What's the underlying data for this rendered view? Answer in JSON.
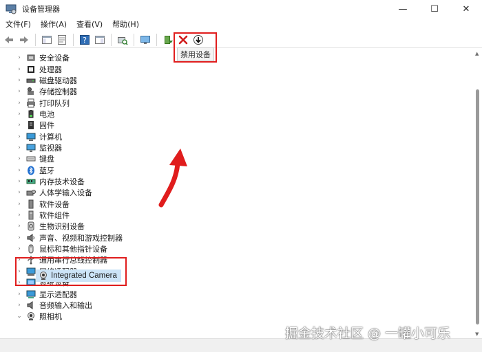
{
  "window": {
    "title": "设备管理器",
    "minimize": "—",
    "maximize": "☐",
    "close": "✕"
  },
  "menu": [
    {
      "label": "文件(F)"
    },
    {
      "label": "操作(A)"
    },
    {
      "label": "查看(V)"
    },
    {
      "label": "帮助(H)"
    }
  ],
  "tooltip": "禁用设备",
  "tree": {
    "categories": [
      {
        "label": "安全设备",
        "icon": "security-device-icon"
      },
      {
        "label": "处理器",
        "icon": "processor-icon"
      },
      {
        "label": "磁盘驱动器",
        "icon": "disk-drive-icon"
      },
      {
        "label": "存储控制器",
        "icon": "storage-controller-icon"
      },
      {
        "label": "打印队列",
        "icon": "printer-icon"
      },
      {
        "label": "电池",
        "icon": "battery-icon"
      },
      {
        "label": "固件",
        "icon": "firmware-icon"
      },
      {
        "label": "计算机",
        "icon": "computer-icon"
      },
      {
        "label": "监视器",
        "icon": "monitor-icon"
      },
      {
        "label": "键盘",
        "icon": "keyboard-icon"
      },
      {
        "label": "蓝牙",
        "icon": "bluetooth-icon"
      },
      {
        "label": "内存技术设备",
        "icon": "memory-device-icon"
      },
      {
        "label": "人体学输入设备",
        "icon": "hid-icon"
      },
      {
        "label": "软件设备",
        "icon": "software-device-icon"
      },
      {
        "label": "软件组件",
        "icon": "software-component-icon"
      },
      {
        "label": "生物识别设备",
        "icon": "biometric-icon"
      },
      {
        "label": "声音、视频和游戏控制器",
        "icon": "sound-icon"
      },
      {
        "label": "鼠标和其他指针设备",
        "icon": "mouse-icon"
      },
      {
        "label": "通用串行总线控制器",
        "icon": "usb-icon"
      },
      {
        "label": "网络适配器",
        "icon": "network-adapter-icon"
      },
      {
        "label": "系统设备",
        "icon": "system-device-icon"
      },
      {
        "label": "显示适配器",
        "icon": "display-adapter-icon"
      },
      {
        "label": "音频输入和输出",
        "icon": "audio-io-icon"
      },
      {
        "label": "照相机",
        "icon": "camera-icon"
      }
    ],
    "selected_child": {
      "label": "Integrated Camera",
      "icon": "camera-icon"
    }
  },
  "watermark": "掘金技术社区 @ 一罐小可乐",
  "colors": {
    "highlight": "#e01d1d",
    "selection": "#cce4f7"
  }
}
